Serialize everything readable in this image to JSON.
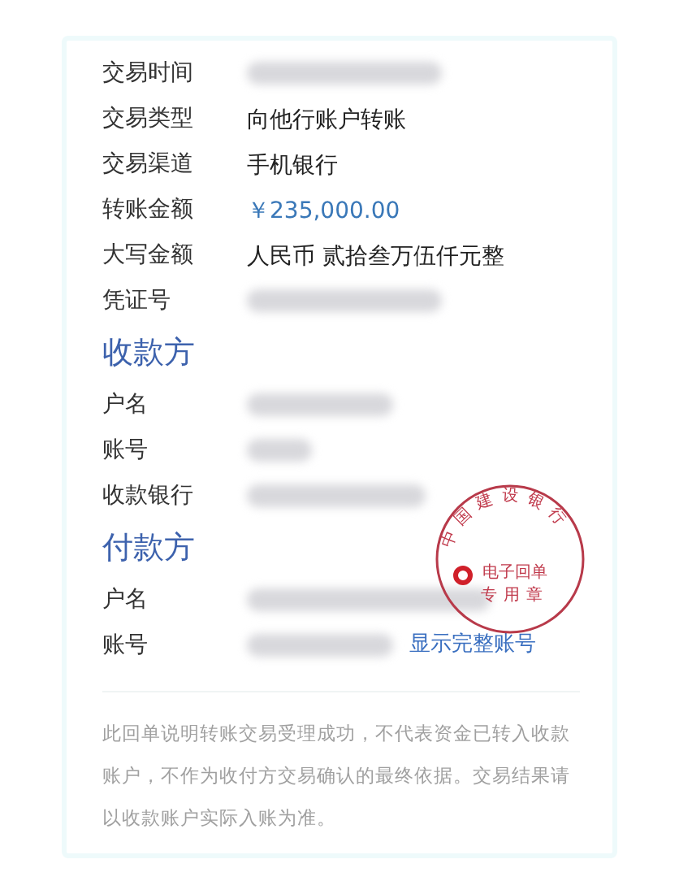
{
  "details": [
    {
      "label": "交易时间",
      "kind": "blurred"
    },
    {
      "label": "交易类型",
      "kind": "text",
      "value": "向他行账户转账"
    },
    {
      "label": "交易渠道",
      "kind": "text",
      "value": "手机银行"
    },
    {
      "label": "转账金额",
      "kind": "amount",
      "value": "￥235,000.00"
    },
    {
      "label": "大写金额",
      "kind": "text",
      "value": "人民币 贰拾叁万伍仟元整"
    },
    {
      "label": "凭证号",
      "kind": "blurred"
    }
  ],
  "payee": {
    "title": "收款方",
    "rows": [
      {
        "label": "户名",
        "kind": "blurred"
      },
      {
        "label": "账号",
        "kind": "blurred"
      },
      {
        "label": "收款银行",
        "kind": "blurred"
      }
    ]
  },
  "payer": {
    "title": "付款方",
    "rows": [
      {
        "label": "户名",
        "kind": "blurred"
      },
      {
        "label": "账号",
        "kind": "blurred",
        "link": "显示完整账号"
      }
    ]
  },
  "stamp": {
    "bank": "中国建设银行",
    "line_1": "电子回单",
    "line_2": "专用章"
  },
  "note": "此回单说明转账交易受理成功，不代表资金已转入收款账户，不作为收付方交易确认的最终依据。交易结果请以收款账户实际入账为准。"
}
